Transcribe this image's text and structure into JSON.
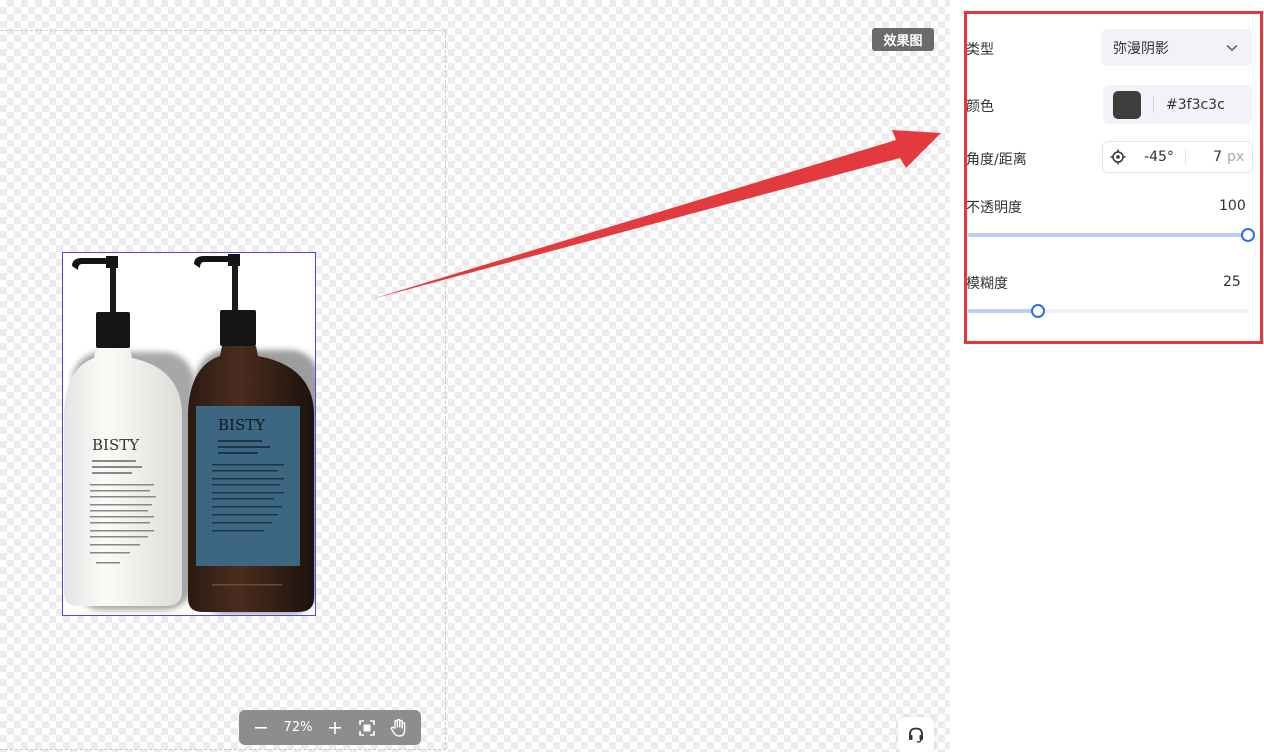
{
  "canvas": {
    "effect_badge": "效果图",
    "product": {
      "left_brand": "BISTY",
      "right_brand": "BISTY"
    }
  },
  "zoom": {
    "value": "72%"
  },
  "panel": {
    "type_label": "类型",
    "type_value": "弥漫阴影",
    "color_label": "颜色",
    "color_hex": "#3f3c3c",
    "angle_label": "角度/距离",
    "angle_value": "-45°",
    "distance_value": "7",
    "distance_unit": "px",
    "opacity_label": "不透明度",
    "opacity_value": "100",
    "opacity_fraction": 1.0,
    "blur_label": "模糊度",
    "blur_value": "25",
    "blur_fraction": 0.25
  },
  "colors": {
    "accent": "#2f6fe4",
    "highlight_frame": "#e2373b",
    "shadow_color": "#3f3c3c"
  },
  "icons": {
    "type_dropdown": "chevron-down-icon",
    "angle": "crosshair-icon",
    "zoom_out": "minus-icon",
    "zoom_in": "plus-icon",
    "fit": "fit-screen-icon",
    "pan": "hand-icon",
    "support": "headset-icon"
  }
}
